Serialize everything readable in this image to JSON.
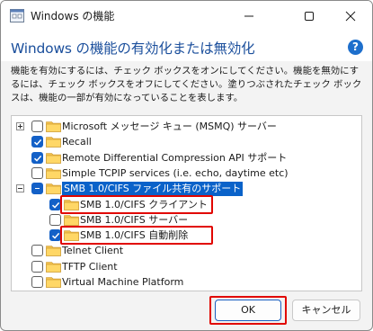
{
  "window": {
    "title": "Windows の機能",
    "heading": "Windows の機能の有効化または無効化",
    "description": "機能を有効にするには、チェック ボックスをオンにしてください。機能を無効にするには、チェック ボックスをオフにしてください。塗りつぶされたチェック ボックスは、機能の一部が有効になっていることを表します。"
  },
  "titlebar_buttons": {
    "minimize": "minimize",
    "maximize": "maximize",
    "close": "close"
  },
  "tree": {
    "items": [
      {
        "label": "Microsoft メッセージ キュー (MSMQ) サーバー",
        "state": "unchecked",
        "expander": "plus",
        "level": 0
      },
      {
        "label": "Recall",
        "state": "checked",
        "level": 0
      },
      {
        "label": "Remote Differential Compression API サポート",
        "state": "checked",
        "level": 0
      },
      {
        "label": "Simple TCPIP services (i.e. echo, daytime etc)",
        "state": "unchecked",
        "level": 0
      },
      {
        "label": "SMB 1.0/CIFS ファイル共有のサポート",
        "state": "partial",
        "expander": "minus",
        "level": 0,
        "selected": true
      },
      {
        "label": "SMB 1.0/CIFS クライアント",
        "state": "checked",
        "level": 1,
        "highlighted": true
      },
      {
        "label": "SMB 1.0/CIFS サーバー",
        "state": "unchecked",
        "level": 1
      },
      {
        "label": "SMB 1.0/CIFS 自動削除",
        "state": "checked",
        "level": 1,
        "highlighted": true
      },
      {
        "label": "Telnet Client",
        "state": "unchecked",
        "level": 0
      },
      {
        "label": "TFTP Client",
        "state": "unchecked",
        "level": 0
      },
      {
        "label": "Virtual Machine Platform",
        "state": "unchecked",
        "level": 0
      },
      {
        "label": "",
        "state": "unchecked",
        "level": 0
      }
    ]
  },
  "buttons": {
    "ok": "OK",
    "cancel": "キャンセル"
  },
  "colors": {
    "accent": "#1360c7",
    "highlight": "#e10600",
    "heading": "#1b4f9c",
    "folder": "#f2c14e"
  }
}
